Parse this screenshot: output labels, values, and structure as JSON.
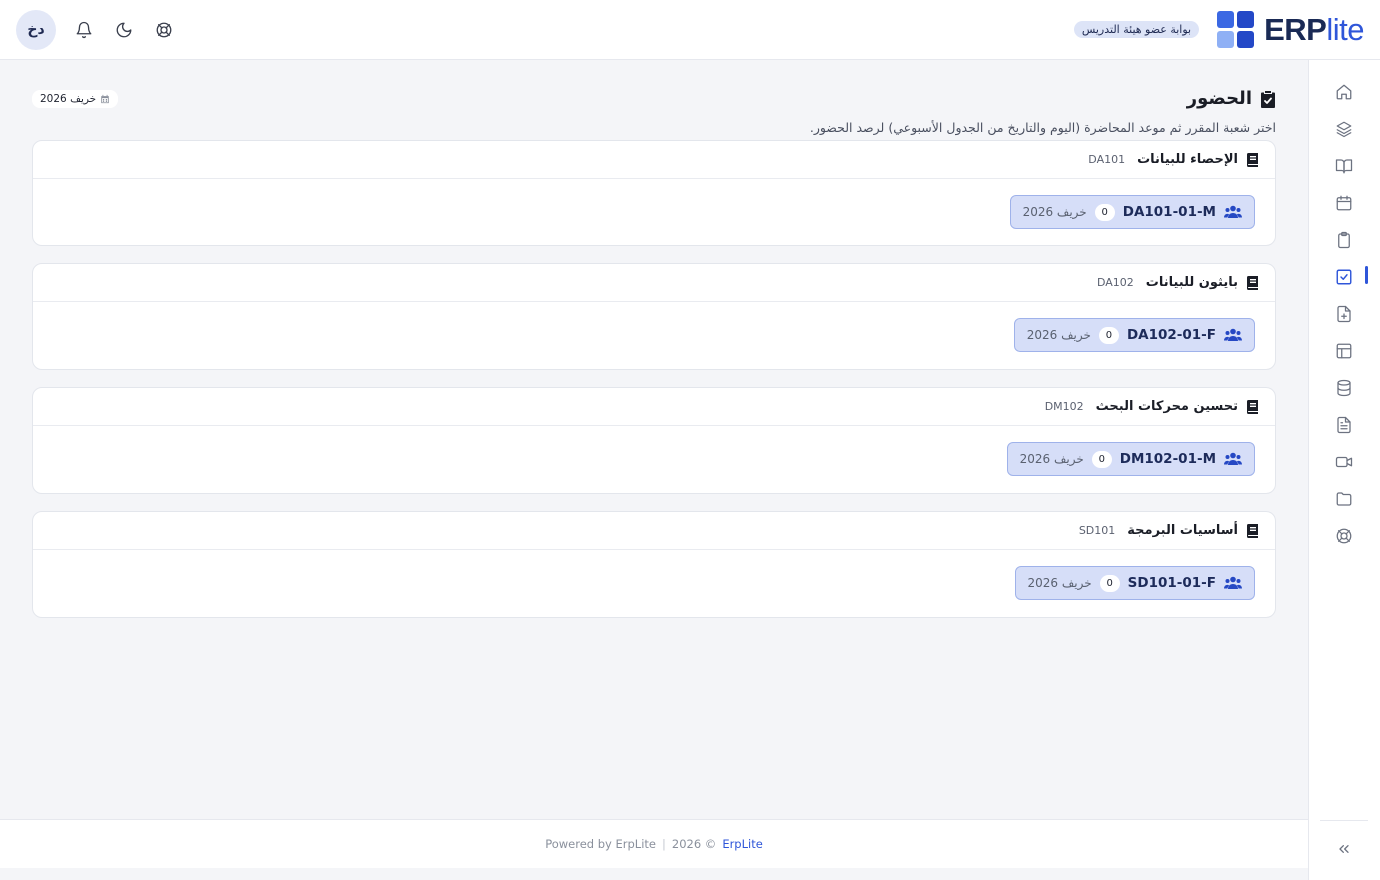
{
  "header": {
    "brand_bold": "ERP",
    "brand_light": "lite",
    "portal_badge": "بوابة عضو هيئة التدريس",
    "avatar_initials": "دخ",
    "icons": [
      "bell-icon",
      "moon-icon",
      "lifebuoy-icon"
    ]
  },
  "sidebar": {
    "items": [
      {
        "name": "home-icon"
      },
      {
        "name": "layers-icon"
      },
      {
        "name": "book-open-icon"
      },
      {
        "name": "calendar-icon"
      },
      {
        "name": "clipboard-icon"
      },
      {
        "name": "checkbox-icon",
        "active": true
      },
      {
        "name": "file-plus-icon"
      },
      {
        "name": "layout-icon"
      },
      {
        "name": "database-icon"
      },
      {
        "name": "file-text-icon"
      },
      {
        "name": "video-icon"
      },
      {
        "name": "folder-icon"
      },
      {
        "name": "lifebuoy-icon"
      }
    ],
    "collapse_icon": "chevrons-left-icon"
  },
  "page": {
    "title": "الحضور",
    "subtitle": "اختر شعبة المقرر ثم موعد المحاضرة (اليوم والتاريخ من الجدول الأسبوعي) لرصد الحضور.",
    "term_chip": "خريف 2026"
  },
  "courses": [
    {
      "name": "الإحصاء للبيانات",
      "code": "DA101",
      "sections": [
        {
          "code": "DA101-01-M",
          "count": "0",
          "term": "خريف 2026"
        }
      ]
    },
    {
      "name": "بايثون للبيانات",
      "code": "DA102",
      "sections": [
        {
          "code": "DA102-01-F",
          "count": "0",
          "term": "خريف 2026"
        }
      ]
    },
    {
      "name": "تحسين محركات البحث",
      "code": "DM102",
      "sections": [
        {
          "code": "DM102-01-M",
          "count": "0",
          "term": "خريف 2026"
        }
      ]
    },
    {
      "name": "أساسيات البرمجة",
      "code": "SD101",
      "sections": [
        {
          "code": "SD101-01-F",
          "count": "0",
          "term": "خريف 2026"
        }
      ]
    }
  ],
  "footer": {
    "powered": "Powered by ErpLite",
    "copyright": "2026 ©",
    "link": "ErpLite"
  },
  "colors": {
    "accent": "#2f56d9",
    "section_bg": "#d6def8",
    "page_bg": "#f4f5f8"
  }
}
